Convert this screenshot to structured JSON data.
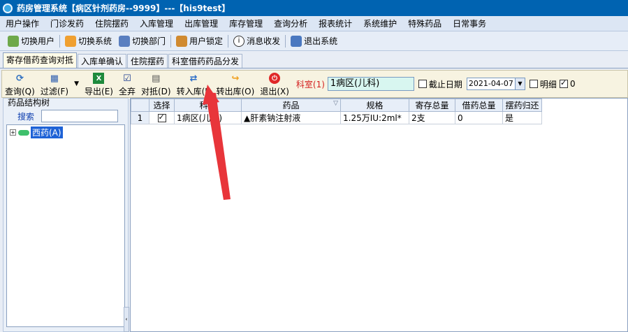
{
  "window": {
    "title": "药房管理系统【病区针剂药房--9999】---【his9test】"
  },
  "menu": [
    "用户操作",
    "门诊发药",
    "住院摆药",
    "入库管理",
    "出库管理",
    "库存管理",
    "查询分析",
    "报表统计",
    "系统维护",
    "特殊药品",
    "日常事务"
  ],
  "sysbar": {
    "switch_user": "切换用户",
    "switch_system": "切换系统",
    "switch_dept": "切换部门",
    "lock_user": "用户锁定",
    "messages": "消息收发",
    "exit_system": "退出系统"
  },
  "tabs": [
    "寄存借药查询对抵",
    "入库单确认",
    "住院摆药",
    "科室借药药品分发"
  ],
  "toolbar": {
    "query": "查询(Q)",
    "filter": "过滤(F)",
    "export": "导出(E)",
    "select_all": "全弃",
    "offset": "对抵(D)",
    "to_stock_in": "转入库(I)",
    "to_stock_out": "转出库(O)",
    "exit": "退出(X)",
    "dept_label": "科室(1)",
    "dept_value": "1病区(儿科)",
    "cutoff_label": "截止日期",
    "cutoff_date": "2021-04-07",
    "detail_label": "明细",
    "zero_label": "0"
  },
  "left_panel": {
    "title": "药品结构树",
    "search_label": "搜索",
    "tree_root": "西药(A)"
  },
  "grid": {
    "headers": [
      "选择",
      "科室",
      "药品",
      "规格",
      "寄存总量",
      "借药总量",
      "摆药归还"
    ],
    "rows": [
      {
        "no": "1",
        "dept": "1病区(儿科)",
        "drug": "▲肝素钠注射液",
        "spec": "1.25万IU:2ml*",
        "deposit": "2支",
        "borrow": "0",
        "return": "是"
      }
    ]
  },
  "colors": {
    "titlebar": "#0063b1",
    "toolbar_bg": "#f7f3e1",
    "dept_field_bg": "#d8f6f0",
    "selected_tree": "#1e62d6",
    "pointer_arrow": "#e8353a"
  }
}
